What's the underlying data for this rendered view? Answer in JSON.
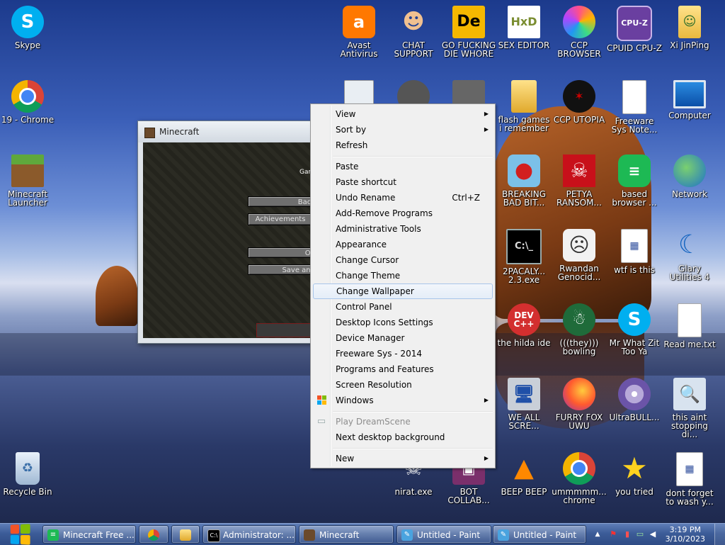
{
  "desktop": {
    "icons": [
      {
        "label": "Skype",
        "icon": "skype-icon"
      },
      {
        "label": "19 - Chrome",
        "icon": "chrome-icon"
      },
      {
        "label": "Minecraft Launcher",
        "icon": "minecraft-icon"
      },
      {
        "label": "Recycle Bin",
        "icon": "recycle-bin-icon"
      },
      {
        "label": "Avast Antivirus",
        "icon": "avast-icon"
      },
      {
        "label": "CHAT SUPPORT",
        "icon": "support-agent-icon"
      },
      {
        "label": "GO FUCKING DIE WHORE",
        "icon": "de-app-icon"
      },
      {
        "label": "SEX EDITOR",
        "icon": "hxd-icon"
      },
      {
        "label": "CCP BROWSER",
        "icon": "colorful-browser-icon"
      },
      {
        "label": "CPUID CPU-Z",
        "icon": "cpuz-icon"
      },
      {
        "label": "Xi JinPing",
        "icon": "folder-user-icon"
      },
      {
        "label": "flash games i remember",
        "icon": "folder-icon"
      },
      {
        "label": "CCP UTOPIA",
        "icon": "utopia-icon"
      },
      {
        "label": "Freeware Sys Note...",
        "icon": "text-file-icon"
      },
      {
        "label": "Computer",
        "icon": "computer-icon"
      },
      {
        "label": "BREAKING BAD BIT...",
        "icon": "angry-bird-icon"
      },
      {
        "label": "PETYA RANSOM...",
        "icon": "skull-icon"
      },
      {
        "label": "based browser ...",
        "icon": "green-chat-icon"
      },
      {
        "label": "Network",
        "icon": "network-icon"
      },
      {
        "label": "2PACALY... 2.3.exe",
        "icon": "cmd-icon"
      },
      {
        "label": "Rwandan Genocid...",
        "icon": "meme-face-icon"
      },
      {
        "label": "wtf is this",
        "icon": "calendar-file-icon"
      },
      {
        "label": "Glary Utilities 4",
        "icon": "glary-icon"
      },
      {
        "label": "the hilda ide",
        "icon": "devcpp-icon"
      },
      {
        "label": "(((they))) bowling",
        "icon": "bowling-icon"
      },
      {
        "label": "Mr What Zit Too Ya",
        "icon": "skype-icon"
      },
      {
        "label": "Read me.txt",
        "icon": "text-file-icon"
      },
      {
        "label": "WE ALL SCRE...",
        "icon": "computer-setup-icon"
      },
      {
        "label": "FURRY FOX UWU",
        "icon": "firefox-icon"
      },
      {
        "label": "UltraBULL...",
        "icon": "disc-icon"
      },
      {
        "label": "this aint stopping di...",
        "icon": "magnifier-computer-icon"
      },
      {
        "label": "nirat.exe",
        "icon": "skull-exe-icon"
      },
      {
        "label": "BOT COLLAB...",
        "icon": "bot-icon"
      },
      {
        "label": "BEEP BEEP",
        "icon": "vlc-icon"
      },
      {
        "label": "ummmmm... chrome",
        "icon": "chrome-icon"
      },
      {
        "label": "you tried",
        "icon": "star-icon"
      },
      {
        "label": "dont forget to wash y...",
        "icon": "calendar-file-icon"
      }
    ]
  },
  "minecraft_window": {
    "title": "Minecraft",
    "game_label": "Gam",
    "buttons": [
      "Back",
      "Achievements",
      "Op",
      "Save and"
    ]
  },
  "context_menu": {
    "items": [
      {
        "label": "View",
        "submenu": true
      },
      {
        "label": "Sort by",
        "submenu": true
      },
      {
        "label": "Refresh"
      },
      {
        "label": "Paste"
      },
      {
        "label": "Paste shortcut"
      },
      {
        "label": "Undo Rename",
        "shortcut": "Ctrl+Z"
      },
      {
        "label": "Add-Remove Programs"
      },
      {
        "label": "Administrative Tools"
      },
      {
        "label": "Appearance"
      },
      {
        "label": "Change Cursor"
      },
      {
        "label": "Change Theme"
      },
      {
        "label": "Change Wallpaper",
        "highlighted": true
      },
      {
        "label": "Control Panel"
      },
      {
        "label": "Desktop Icons Settings"
      },
      {
        "label": "Device Manager"
      },
      {
        "label": "Freeware Sys - 2014"
      },
      {
        "label": "Programs and Features"
      },
      {
        "label": "Screen Resolution"
      },
      {
        "label": "Windows",
        "submenu": true,
        "icon": "windows-logo-icon"
      },
      {
        "label": "Play DreamScene",
        "disabled": true,
        "icon": "dreamscene-icon"
      },
      {
        "label": "Next desktop background"
      },
      {
        "label": "New",
        "submenu": true
      }
    ]
  },
  "taskbar": {
    "items": [
      {
        "label": "Minecraft Free ...",
        "icon": "green-chat-icon"
      },
      {
        "label": "",
        "icon": "chrome-icon"
      },
      {
        "label": "",
        "icon": "folder-icon"
      },
      {
        "label": "Administrator: ...",
        "icon": "cmd-icon"
      },
      {
        "label": "Minecraft",
        "icon": "minecraft-icon"
      },
      {
        "label": "Untitled - Paint",
        "icon": "paint-icon"
      },
      {
        "label": "Untitled - Paint",
        "icon": "paint-icon"
      }
    ],
    "clock": {
      "time": "3:19 PM",
      "date": "3/10/2023"
    }
  }
}
